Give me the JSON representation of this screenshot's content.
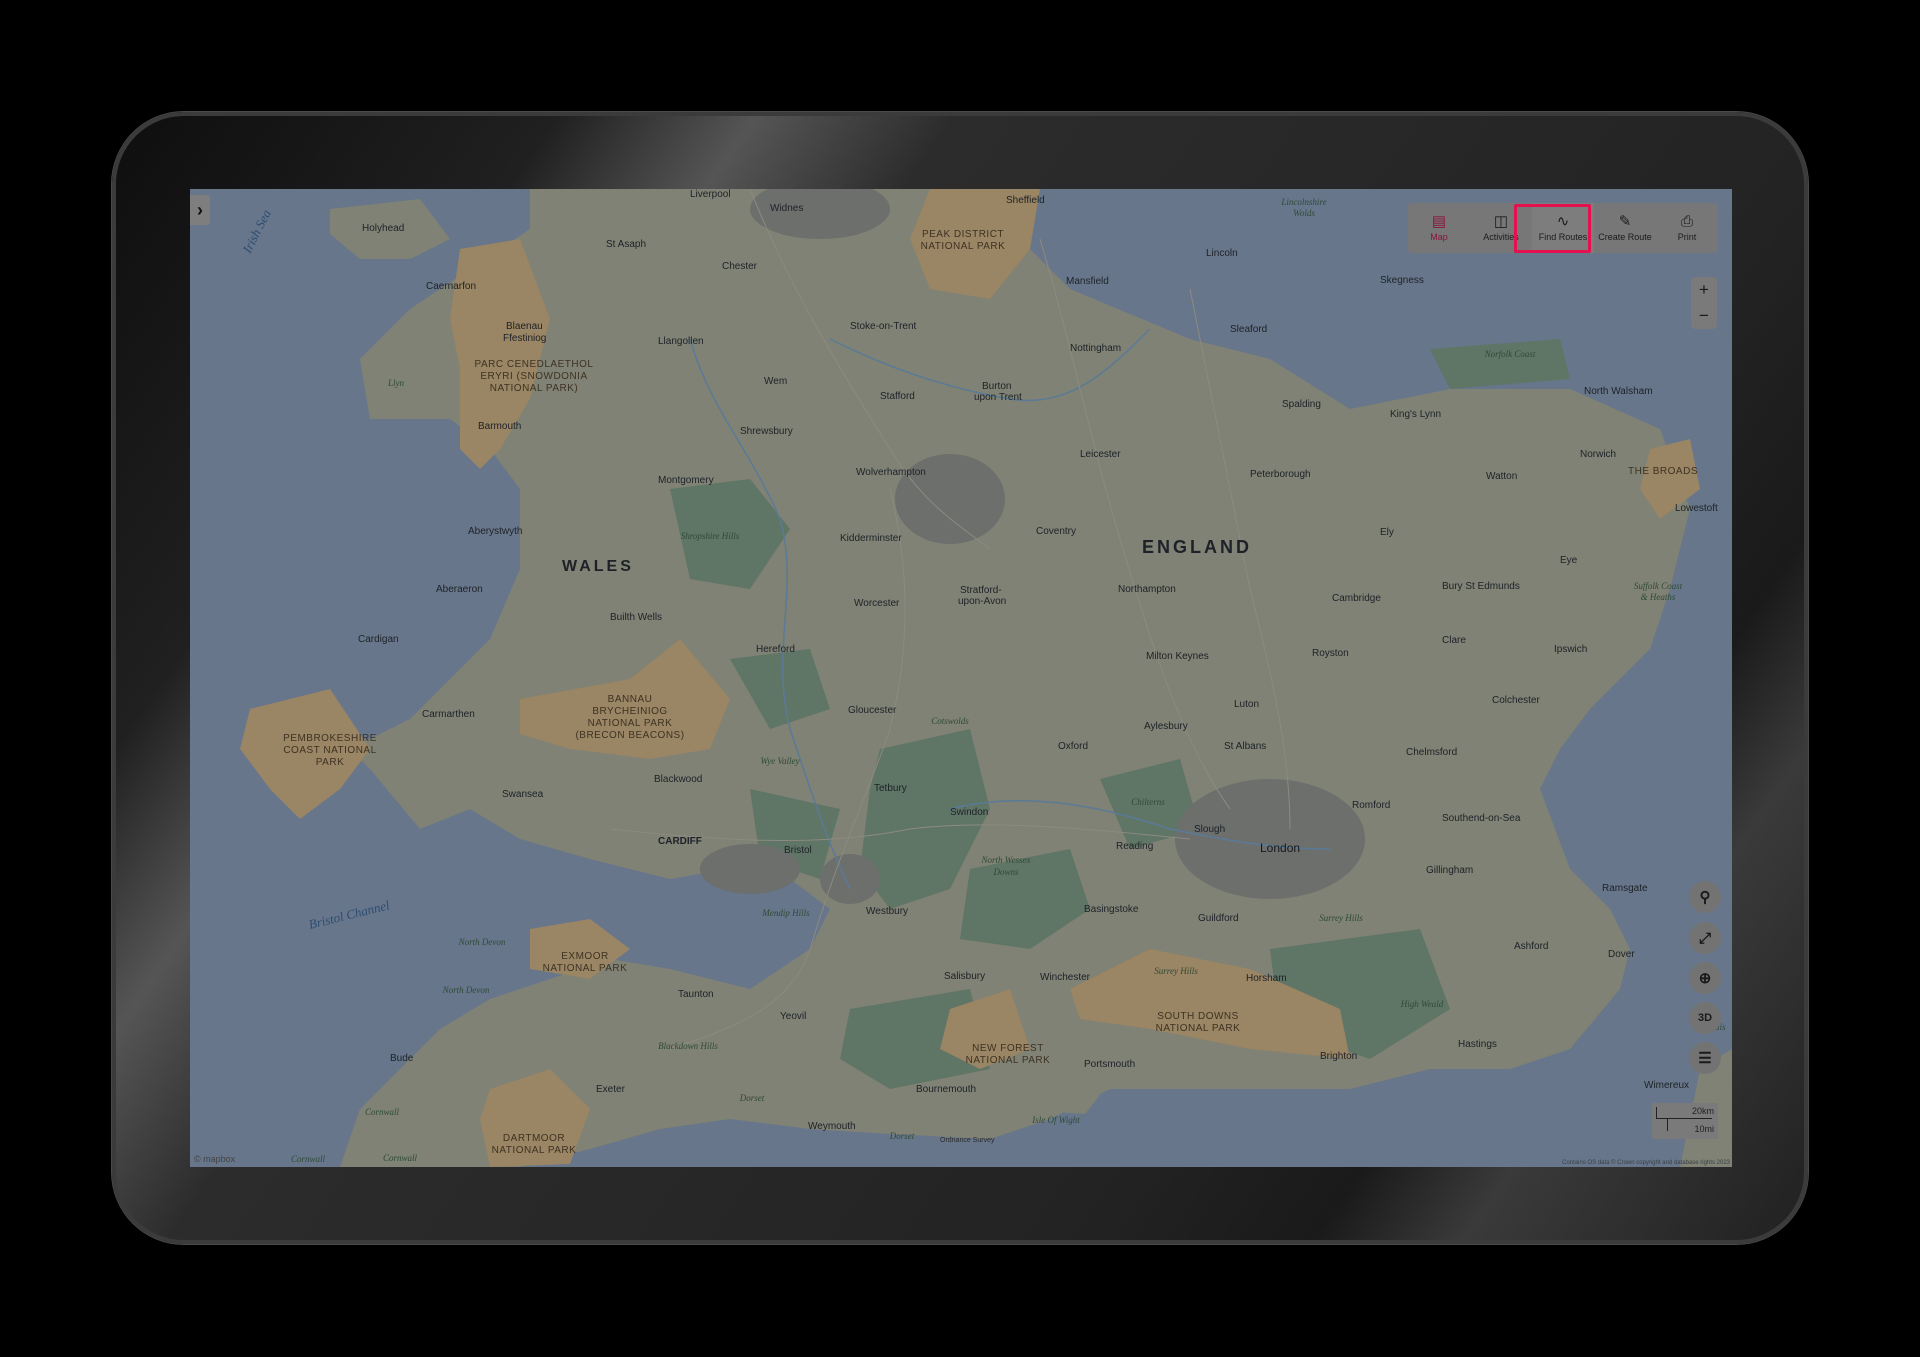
{
  "toolbar": {
    "items": [
      {
        "label": "Map",
        "icon": "map-icon",
        "active": true
      },
      {
        "label": "Activities",
        "icon": "activities-icon"
      },
      {
        "label": "Find Routes",
        "icon": "find-routes-icon",
        "highlighted": true
      },
      {
        "label": "Create Route",
        "icon": "pencil-icon"
      },
      {
        "label": "Print",
        "icon": "printer-icon"
      }
    ],
    "highlight_color": "#e4104f",
    "active_color": "#8a1440"
  },
  "zoom": {
    "in": "+",
    "out": "−"
  },
  "controls": {
    "three_d": "3D"
  },
  "scale": {
    "km": "20km",
    "mi": "10mi"
  },
  "attribution": "Contains OS data © Crown copyright and database rights 2023",
  "branding": {
    "mapbox": "© mapbox",
    "os": "Ordnance Survey"
  },
  "map": {
    "countries": {
      "wales": "WALES",
      "england": "ENGLAND"
    },
    "water": {
      "irish_sea": "Irish Sea",
      "bristol_channel": "Bristol Channel"
    },
    "parks": {
      "peak_l1": "PEAK DISTRICT",
      "peak_l2": "NATIONAL PARK",
      "snow_l1": "PARC CENEDLAETHOL",
      "snow_l2": "ERYRI (SNOWDONIA",
      "snow_l3": "NATIONAL PARK)",
      "pemb_l1": "PEMBROKESHIRE",
      "pemb_l2": "COAST NATIONAL",
      "pemb_l3": "PARK",
      "bann_l1": "BANNAU",
      "bann_l2": "BRYCHEINIOG",
      "bann_l3": "NATIONAL PARK",
      "bann_l4": "(BRECON BEACONS)",
      "exm_l1": "EXMOOR",
      "exm_l2": "NATIONAL PARK",
      "dart_l1": "DARTMOOR",
      "dart_l2": "NATIONAL PARK",
      "nf_l1": "NEW FOREST",
      "nf_l2": "NATIONAL PARK",
      "sd_l1": "SOUTH DOWNS",
      "sd_l2": "NATIONAL PARK",
      "broads": "THE BROADS"
    },
    "areas": {
      "lincs_l1": "Lincolnshire",
      "lincs_l2": "Wolds",
      "norfolk_coast": "Norfolk Coast",
      "shropshire": "Shropshire Hills",
      "cotswolds": "Cotswolds",
      "wye": "Wye Valley",
      "chilterns": "Chilterns",
      "nwessex_l1": "North Wessex",
      "nwessex_l2": "Downs",
      "mendip": "Mendip Hills",
      "surrey1": "Surrey Hills",
      "surrey2": "Surrey Hills",
      "highweald": "High Weald",
      "suffolk_l1": "Suffolk Coast",
      "suffolk_l2": "& Heaths",
      "northdevon1": "North Devon",
      "northdevon2": "North Devon",
      "blackdown": "Blackdown Hills",
      "dorset1": "Dorset",
      "dorset2": "Dorset",
      "iow": "Isle Of Wight",
      "cornwall1": "Cornwall",
      "cornwall2": "Cornwall",
      "cornwall3": "Cornwall",
      "llyn": "Llyn",
      "nais": "nais"
    },
    "cities": {
      "liverpool": "Liverpool",
      "widnes": "Widnes",
      "sheffield": "Sheffield",
      "holyhead": "Holyhead",
      "st_asaph": "St Asaph",
      "chester": "Chester",
      "caernarfon": "Caernarfon",
      "blaenau_l1": "Blaenau",
      "blaenau_l2": "Ffestiniog",
      "llangollen": "Llangollen",
      "stoke": "Stoke-on-Trent",
      "mansfield": "Mansfield",
      "lincoln": "Lincoln",
      "skegness": "Skegness",
      "nottingham": "Nottingham",
      "sleaford": "Sleaford",
      "wem": "Wem",
      "stafford": "Stafford",
      "burton_l1": "Burton",
      "burton_l2": "upon Trent",
      "spalding": "Spalding",
      "kings_lynn": "King's Lynn",
      "north_walsham": "North Walsham",
      "barmouth": "Barmouth",
      "shrewsbury": "Shrewsbury",
      "leicester": "Leicester",
      "norwich": "Norwich",
      "wolverhampton": "Wolverhampton",
      "peterborough": "Peterborough",
      "watton": "Watton",
      "lowestoft": "Lowestoft",
      "montgomery": "Montgomery",
      "aberystwyth": "Aberystwyth",
      "kidderminster": "Kidderminster",
      "coventry": "Coventry",
      "ely": "Ely",
      "eye": "Eye",
      "aberaeron": "Aberaeron",
      "northampton": "Northampton",
      "stratford_l1": "Stratford-",
      "stratford_l2": "upon-Avon",
      "bury": "Bury St Edmunds",
      "cambridge": "Cambridge",
      "worcester": "Worcester",
      "builth": "Builth Wells",
      "cardigan": "Cardigan",
      "hereford": "Hereford",
      "milton_keynes": "Milton Keynes",
      "royston": "Royston",
      "clare": "Clare",
      "ipswich": "Ipswich",
      "carmarthen": "Carmarthen",
      "gloucester": "Gloucester",
      "luton": "Luton",
      "colchester": "Colchester",
      "aylesbury": "Aylesbury",
      "oxford": "Oxford",
      "st_albans": "St Albans",
      "chelmsford": "Chelmsford",
      "blackwood": "Blackwood",
      "tetbury": "Tetbury",
      "swansea": "Swansea",
      "swindon": "Swindon",
      "romford": "Romford",
      "southend": "Southend-on-Sea",
      "slough": "Slough",
      "cardiff": "CARDIFF",
      "bristol": "Bristol",
      "reading": "Reading",
      "london": "London",
      "gillingham": "Gillingham",
      "ramsgate": "Ramsgate",
      "westbury": "Westbury",
      "basingstoke": "Basingstoke",
      "guildford": "Guildford",
      "ashford": "Ashford",
      "dover": "Dover",
      "salisbury": "Salisbury",
      "winchester": "Winchester",
      "horsham": "Horsham",
      "taunton": "Taunton",
      "yeovil": "Yeovil",
      "bude": "Bude",
      "portsmouth": "Portsmouth",
      "brighton": "Brighton",
      "hastings": "Hastings",
      "exeter": "Exeter",
      "bournemouth": "Bournemouth",
      "weymouth": "Weymouth",
      "wimereux": "Wimereux"
    }
  }
}
